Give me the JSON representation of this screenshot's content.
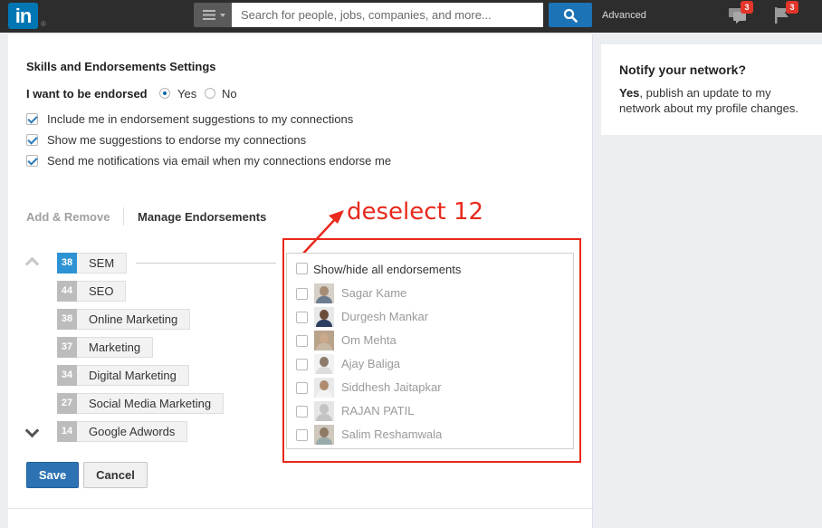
{
  "header": {
    "logo_text": "in",
    "logo_mark": "®",
    "search_placeholder": "Search for people, jobs, companies, and more...",
    "advanced_label": "Advanced",
    "messages_badge": "3",
    "notifications_badge": "3"
  },
  "settings": {
    "title": "Skills and Endorsements Settings",
    "endorse_label": "I want to be endorsed",
    "yes_label": "Yes",
    "no_label": "No",
    "selected": "Yes",
    "options": [
      {
        "label": "Include me in endorsement suggestions to my connections",
        "checked": true
      },
      {
        "label": "Show me suggestions to endorse my connections",
        "checked": true
      },
      {
        "label": "Send me notifications via email when my connections endorse me",
        "checked": true
      }
    ]
  },
  "tabs": {
    "add_remove": "Add & Remove",
    "manage": "Manage Endorsements"
  },
  "annotation": {
    "text": "deselect 12",
    "color": "#e8291c"
  },
  "skills": [
    {
      "count": "38",
      "name": "SEM",
      "active": true
    },
    {
      "count": "44",
      "name": "SEO"
    },
    {
      "count": "38",
      "name": "Online Marketing"
    },
    {
      "count": "37",
      "name": "Marketing"
    },
    {
      "count": "34",
      "name": "Digital Marketing"
    },
    {
      "count": "27",
      "name": "Social Media Marketing"
    },
    {
      "count": "14",
      "name": "Google Adwords"
    }
  ],
  "endorsers": {
    "show_all_label": "Show/hide all endorsements",
    "people": [
      {
        "name": "Sagar Kame"
      },
      {
        "name": "Durgesh Mankar"
      },
      {
        "name": "Om Mehta"
      },
      {
        "name": "Ajay Baliga"
      },
      {
        "name": "Siddhesh Jaitapkar"
      },
      {
        "name": "RAJAN PATIL"
      },
      {
        "name": "Salim Reshamwala"
      }
    ]
  },
  "buttons": {
    "save": "Save",
    "cancel": "Cancel"
  },
  "sidebar": {
    "title": "Notify your network?",
    "bold": "Yes",
    "text": ", publish an update to my network about my profile changes."
  },
  "colors": {
    "brand": "#0077b5",
    "active_skill": "#2e93d4",
    "save_button": "#2d73b3"
  }
}
